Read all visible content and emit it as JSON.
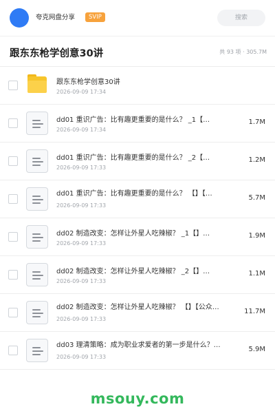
{
  "header": {
    "brand": "夸克网盘分享",
    "badge": "SVIP",
    "search_placeholder": "搜索"
  },
  "folder": {
    "title": "跟东东枪学创意30讲",
    "meta": "共 93 项 · 305.7M"
  },
  "items": [
    {
      "type": "folder",
      "name": "跟东东枪学创意30讲",
      "date": "2026-09-09 17:34",
      "size": ""
    },
    {
      "type": "file",
      "name": "dd01 重识广告：比有趣更重要的是什么？ _1【…",
      "date": "2026-09-09 17:34",
      "size": "1.7M"
    },
    {
      "type": "file",
      "name": "dd01 重识广告：比有趣更重要的是什么？ _2【…",
      "date": "2026-09-09 17:33",
      "size": "1.2M"
    },
    {
      "type": "file",
      "name": "dd01 重识广告：比有趣更重要的是什么？ 【】【…",
      "date": "2026-09-09 17:33",
      "size": "5.7M"
    },
    {
      "type": "file",
      "name": "dd02 制造改变：怎样让外星人吃辣椒？ _1【】…",
      "date": "2026-09-09 17:33",
      "size": "1.9M"
    },
    {
      "type": "file",
      "name": "dd02 制造改变：怎样让外星人吃辣椒？ _2【】…",
      "date": "2026-09-09 17:33",
      "size": "1.1M"
    },
    {
      "type": "file",
      "name": "dd02 制造改变：怎样让外星人吃辣椒？ 【】【公众…",
      "date": "2026-09-09 17:33",
      "size": "11.7M"
    },
    {
      "type": "file",
      "name": "dd03 理清策略：成为职业求爱者的第一步是什么？…",
      "date": "2026-09-09 17:33",
      "size": "5.9M"
    }
  ],
  "footer": {
    "watermark": "msouy.com"
  },
  "colors": {
    "accent": "#2f7bf5",
    "badge": "#f7a23c",
    "folder": "#f7c52b",
    "watermark": "#34b85c"
  }
}
